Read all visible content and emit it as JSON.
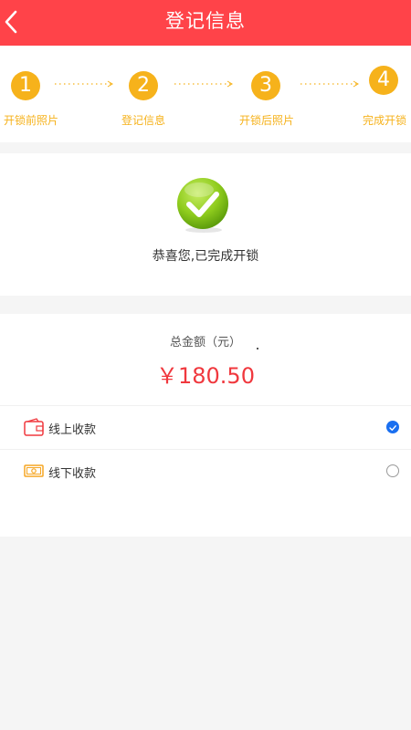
{
  "header": {
    "title": "登记信息"
  },
  "steps": [
    {
      "number": "1",
      "label": "开锁前照片"
    },
    {
      "number": "2",
      "label": "登记信息"
    },
    {
      "number": "3",
      "label": "开锁后照片"
    },
    {
      "number": "4",
      "label": "完成开锁"
    }
  ],
  "success": {
    "message": "恭喜您,已完成开锁"
  },
  "payment": {
    "total_label": "总金额（元）",
    "total_amount": "￥180.50",
    "options": [
      {
        "label": "线上收款",
        "icon": "wallet-icon",
        "selected": true
      },
      {
        "label": "线下收款",
        "icon": "cash-icon",
        "selected": false
      }
    ]
  },
  "colors": {
    "header": "#ff4349",
    "step": "#f6b21b",
    "amount": "#f0383e",
    "radio_selected": "#1a6ff0"
  }
}
